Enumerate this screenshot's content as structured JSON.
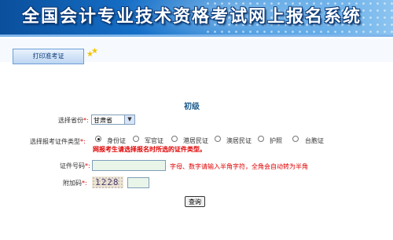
{
  "header": {
    "title": "全国会计专业技术资格考试网上报名系统"
  },
  "nav": {
    "tab_label": "打印准考证"
  },
  "form": {
    "section_title": "初级",
    "province": {
      "label": "选择省份",
      "required_mark": "*:",
      "value": "甘肃省"
    },
    "id_type": {
      "label": "选择报考证件类型",
      "required_mark": "*:",
      "options": [
        {
          "label": "身份证",
          "checked": true
        },
        {
          "label": "军官证",
          "checked": false
        },
        {
          "label": "港居民证",
          "checked": false
        },
        {
          "label": "澳居民证",
          "checked": false
        },
        {
          "label": "护照",
          "checked": false
        },
        {
          "label": "台胞证",
          "checked": false
        }
      ],
      "warning": "网报考生请选择报名时所选的证件类型。"
    },
    "id_number": {
      "label": "证件号码",
      "required_mark": "*:",
      "value": "",
      "hint": "字母、数字请输入半角字符，全角会自动转为半角"
    },
    "captcha": {
      "label": "附加码",
      "required_mark": "*:",
      "code": "1228",
      "value": ""
    },
    "submit_label": "查询"
  },
  "colors": {
    "accent": "#1a5a8c",
    "warning": "#e00000",
    "banner": "#1670c8"
  }
}
